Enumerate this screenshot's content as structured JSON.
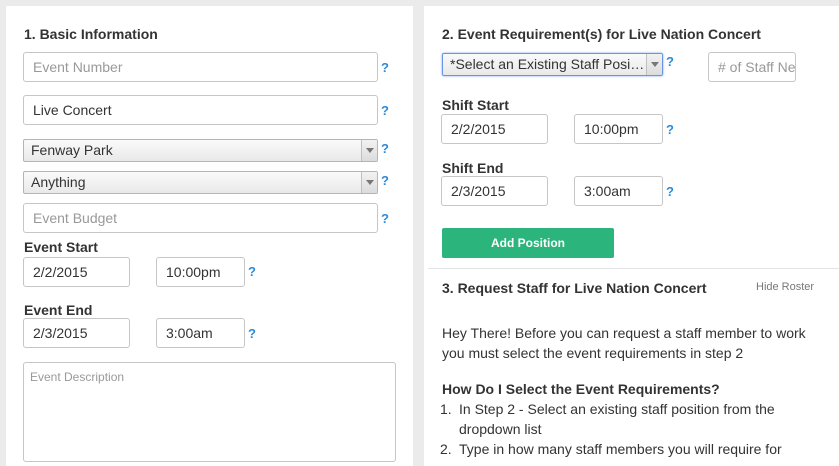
{
  "basic": {
    "title": "1. Basic Information",
    "event_number_placeholder": "Event Number",
    "event_name_value": "Live Concert",
    "venue_select": "Fenway Park",
    "type_select": "Anything",
    "budget_placeholder": "Event Budget",
    "event_start_label": "Event Start",
    "start_date": "2/2/2015",
    "start_time": "10:00pm",
    "event_end_label": "Event End",
    "end_date": "2/3/2015",
    "end_time": "3:00am",
    "description_placeholder": "Event Description"
  },
  "requirements": {
    "title": "2. Event Requirement(s) for Live Nation Concert",
    "position_select": "*Select an Existing Staff Posi…",
    "staff_count_placeholder": "# of Staff Needed",
    "shift_start_label": "Shift Start",
    "shift_start_date": "2/2/2015",
    "shift_start_time": "10:00pm",
    "shift_end_label": "Shift End",
    "shift_end_date": "2/3/2015",
    "shift_end_time": "3:00am",
    "add_position_label": "Add Position"
  },
  "request": {
    "title": "3. Request Staff for Live Nation Concert",
    "hide_roster": "Hide Roster",
    "intro": "Hey There! Before you can request a staff member to work you must select the event requirements in step 2",
    "how_heading": "How Do I Select the Event Requirements?",
    "steps": [
      {
        "num": "1.",
        "text": "In Step 2 - Select an existing staff position from the dropdown list"
      },
      {
        "num": "2.",
        "text": "Type in how many staff members you will require for"
      }
    ]
  },
  "help_mark": "?"
}
